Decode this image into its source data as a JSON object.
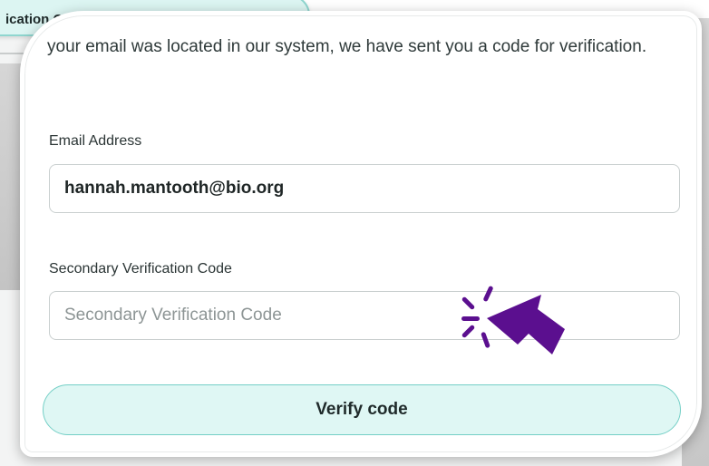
{
  "background": {
    "tab_label": "ication Co"
  },
  "form": {
    "intro_text": "your email was located in our system, we have sent you a code for verification.",
    "email_label": "Email Address",
    "email_value": "hannah.mantooth@bio.org",
    "code_label": "Secondary Verification Code",
    "code_placeholder": "Secondary Verification Code",
    "code_value": "",
    "verify_label": "Verify code"
  },
  "icons": {
    "cursor": "click-pointer-icon"
  },
  "colors": {
    "accent_fill": "#dff7f4",
    "accent_border": "#74cfc6",
    "cursor": "#5b0f8f"
  }
}
